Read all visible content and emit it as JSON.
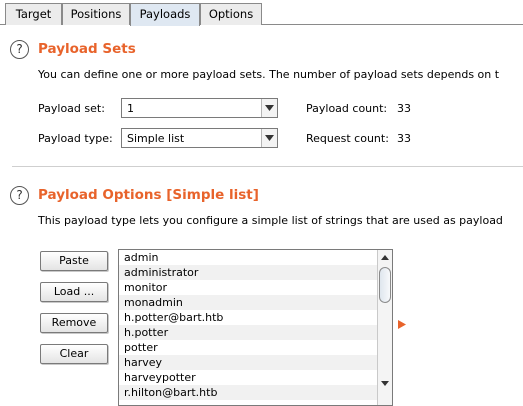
{
  "tabs": [
    {
      "label": "Target",
      "active": false
    },
    {
      "label": "Positions",
      "active": false
    },
    {
      "label": "Payloads",
      "active": true
    },
    {
      "label": "Options",
      "active": false
    }
  ],
  "payload_sets": {
    "help_icon": "?",
    "title": "Payload Sets",
    "description": "You can define one or more payload sets. The number of payload sets depends on t",
    "payload_set_label": "Payload set:",
    "payload_set_value": "1",
    "payload_type_label": "Payload type:",
    "payload_type_value": "Simple list",
    "payload_count_label": "Payload count:",
    "payload_count": "33",
    "request_count_label": "Request count:",
    "request_count": "33"
  },
  "payload_options": {
    "help_icon": "?",
    "title": "Payload Options [Simple list]",
    "description": "This payload type lets you configure a simple list of strings that are used as payload",
    "buttons": {
      "paste": "Paste",
      "load": "Load ...",
      "remove": "Remove",
      "clear": "Clear"
    },
    "items": [
      "admin",
      "administrator",
      "monitor",
      "monadmin",
      "h.potter@bart.htb",
      "h.potter",
      "potter",
      "harvey",
      "harveypotter",
      "r.hilton@bart.htb"
    ]
  },
  "colors": {
    "section_title": "#e8632b",
    "active_tab": "#dfe8f2",
    "marker_arrow": "#e8632b"
  },
  "icons": {
    "dropdown": "triangle-down",
    "scroll_up": "triangle-up",
    "scroll_down": "triangle-down",
    "insert_marker": "triangle-right"
  }
}
